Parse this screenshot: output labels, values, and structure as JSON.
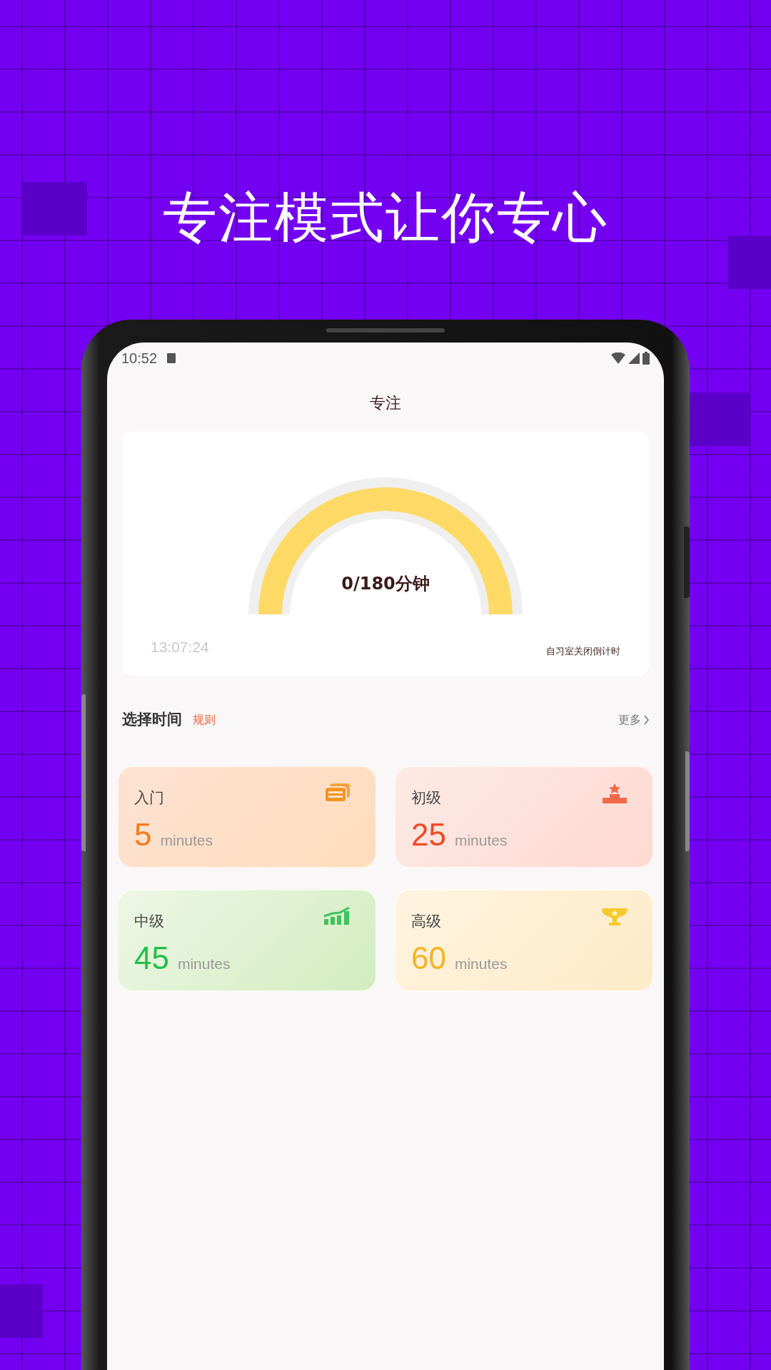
{
  "headline": "专注模式让你专心",
  "status_bar": {
    "time": "10:52"
  },
  "title": "专注",
  "gauge": {
    "reading": "0/180分钟",
    "time": "13:07:24",
    "caption": "自习室关闭倒计时"
  },
  "section": {
    "title": "选择时间",
    "link": "规则",
    "more": "更多"
  },
  "levels": [
    {
      "kind": "cards",
      "name": "入门",
      "number": "5",
      "unit": "minutes",
      "color": "#f57c1f"
    },
    {
      "kind": "podium",
      "name": "初级",
      "number": "25",
      "unit": "minutes",
      "color": "#ef4a22"
    },
    {
      "kind": "chart",
      "name": "中级",
      "number": "45",
      "unit": "minutes",
      "color": "#22c04a"
    },
    {
      "kind": "trophy",
      "name": "高级",
      "number": "60",
      "unit": "minutes",
      "color": "#f5b326"
    }
  ]
}
